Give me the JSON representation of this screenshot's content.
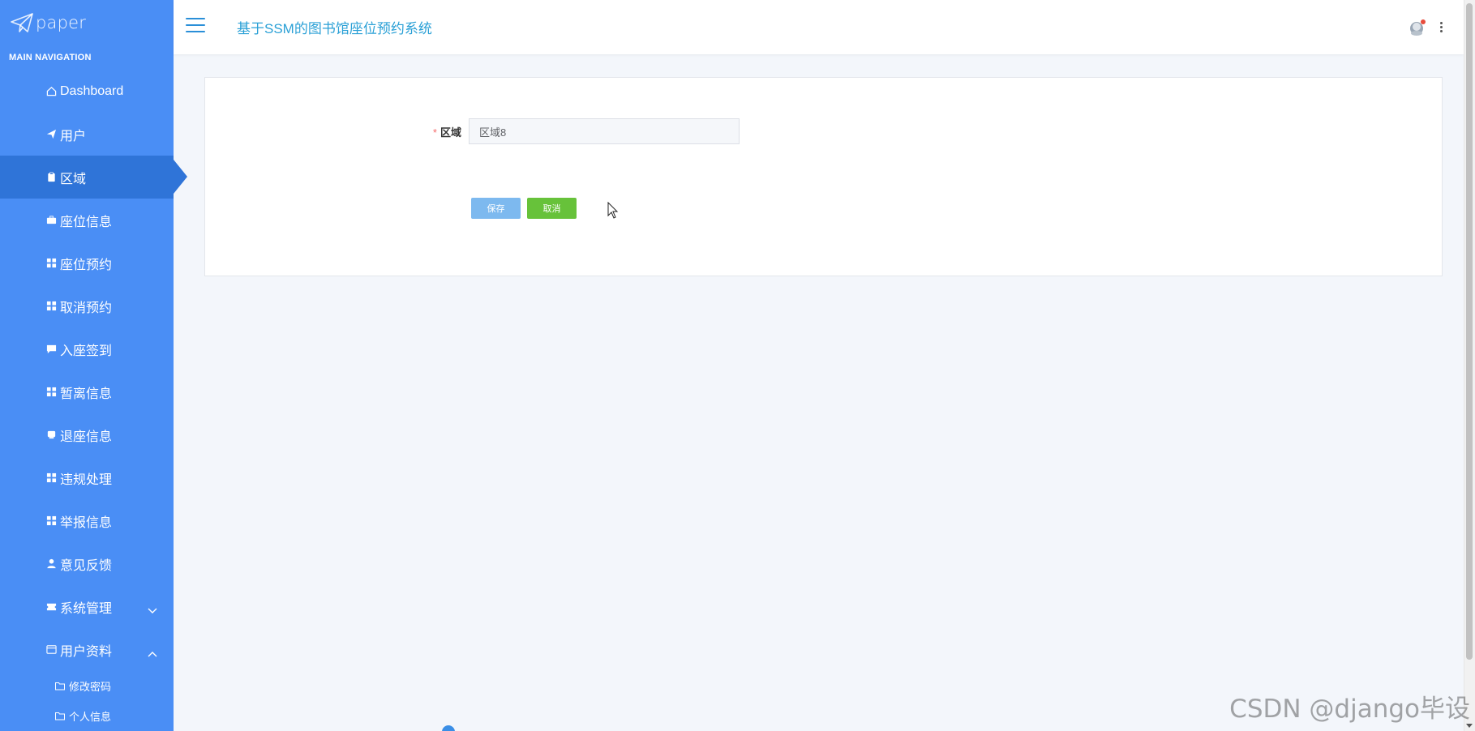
{
  "brand": {
    "text": "paper",
    "icon": "paper-plane-icon"
  },
  "nav_heading": "MAIN NAVIGATION",
  "header": {
    "title": "基于SSM的图书馆座位预约系统"
  },
  "sidebar": {
    "items": [
      {
        "label": "Dashboard",
        "icon": "home-icon"
      },
      {
        "label": "用户",
        "icon": "send-icon"
      },
      {
        "label": "区域",
        "icon": "clipboard-icon",
        "active": true
      },
      {
        "label": "座位信息",
        "icon": "briefcase-icon"
      },
      {
        "label": "座位预约",
        "icon": "grid-icon"
      },
      {
        "label": "取消预约",
        "icon": "grid-icon"
      },
      {
        "label": "入座签到",
        "icon": "comment-icon"
      },
      {
        "label": "暂离信息",
        "icon": "grid-icon"
      },
      {
        "label": "退座信息",
        "icon": "card-icon"
      },
      {
        "label": "违规处理",
        "icon": "grid-icon"
      },
      {
        "label": "举报信息",
        "icon": "grid-icon"
      },
      {
        "label": "意见反馈",
        "icon": "user-icon"
      },
      {
        "label": "系统管理",
        "icon": "ticket-icon",
        "expandable": true,
        "expanded": false
      },
      {
        "label": "用户资料",
        "icon": "profile-card-icon",
        "expandable": true,
        "expanded": true
      }
    ],
    "sub_items": [
      {
        "label": "修改密码",
        "icon": "folder-icon"
      },
      {
        "label": "个人信息",
        "icon": "folder-icon"
      }
    ]
  },
  "form": {
    "field_label": "区域",
    "field_value": "区域8",
    "required_mark": "*",
    "save_label": "保存",
    "cancel_label": "取消"
  },
  "watermark": "CSDN @django毕设",
  "colors": {
    "sidebar": "#4a8ef5",
    "sidebar_active": "#2f74d8",
    "title": "#2aa0d6",
    "save_button": "#7db9ef",
    "cancel_button": "#67c23a"
  }
}
